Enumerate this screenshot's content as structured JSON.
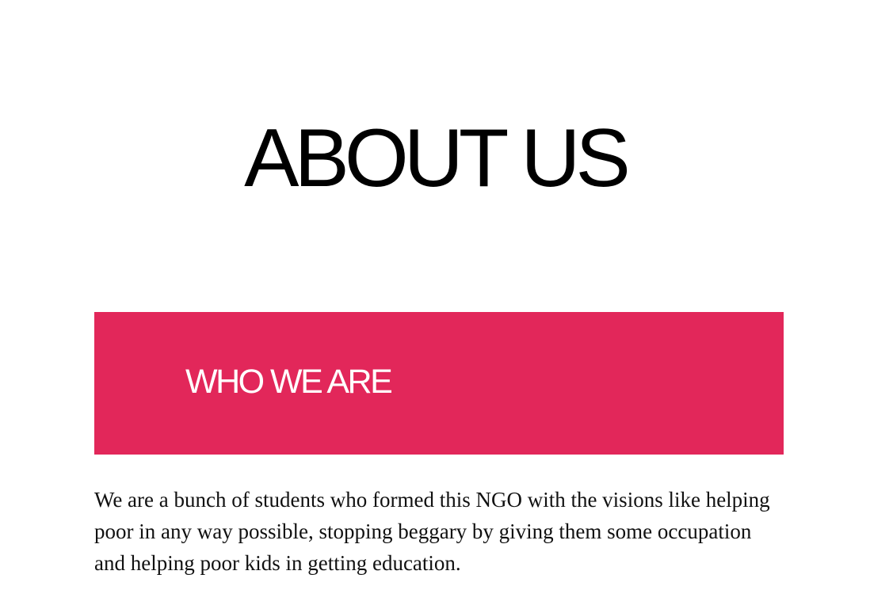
{
  "header": {
    "title": "ABOUT US"
  },
  "who_we_are": {
    "heading": "WHO WE ARE",
    "body": "We are a bunch of students who formed this NGO with the visions like helping poor in any way possible, stopping beggary by giving them some occupation and helping poor kids in getting education."
  },
  "colors": {
    "accent": "#e2275a",
    "banner_text": "#ffffff",
    "text": "#000000",
    "background": "#ffffff"
  }
}
